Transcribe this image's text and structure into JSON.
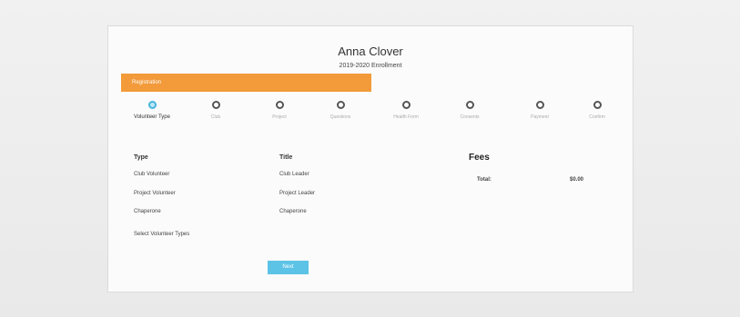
{
  "profile": {
    "name": "Anna Clover",
    "enrollment": "2019-2020 Enrollment"
  },
  "progress_banner": {
    "label": "Registration"
  },
  "steps": [
    {
      "label": "Volunteer Type",
      "active": true
    },
    {
      "label": "Club",
      "active": false
    },
    {
      "label": "Project",
      "active": false
    },
    {
      "label": "Questions",
      "active": false
    },
    {
      "label": "Health Form",
      "active": false
    },
    {
      "label": "Consents",
      "active": false
    },
    {
      "label": "Payment",
      "active": false
    },
    {
      "label": "Confirm",
      "active": false
    }
  ],
  "volunteer_table": {
    "type_header": "Type",
    "title_header": "Title",
    "rows": [
      {
        "type": "Club Volunteer",
        "title": "Club Leader"
      },
      {
        "type": "Project Volunteer",
        "title": "Project Leader"
      },
      {
        "type": "Chaperone",
        "title": "Chaperone"
      }
    ]
  },
  "fees": {
    "header": "Fees",
    "total_label": "Total:",
    "total_value": "$0.00"
  },
  "actions": {
    "select_types": "Select Volunteer Types",
    "next": "Next"
  },
  "colors": {
    "banner": "#f39a3a",
    "active_step": "#46b5df",
    "next_button": "#5cc3e6"
  }
}
